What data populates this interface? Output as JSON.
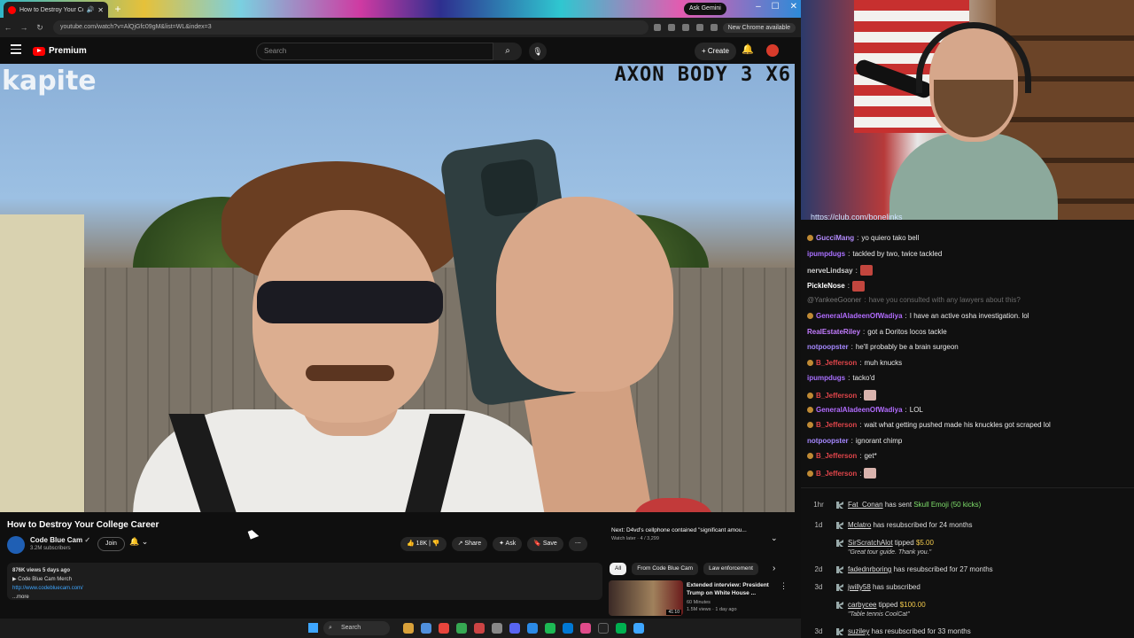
{
  "browser": {
    "tab_title": "How to Destroy Your Colle",
    "gemini_label": "Ask Gemini",
    "url": "youtube.com/watch?v=AlQjGfc09gM&list=WL&index=3",
    "new_chrome_label": "New Chrome available"
  },
  "youtube": {
    "logo_text": "Premium",
    "search_placeholder": "Search",
    "create_label": "Create"
  },
  "video": {
    "watermark_left": "kapite",
    "watermark_right": "AXON BODY 3 X6"
  },
  "details": {
    "title": "How to Destroy Your College Career",
    "channel_name": "Code Blue Cam",
    "subscribers": "3.2M subscribers",
    "join_label": "Join",
    "like_count": "18K",
    "share_label": "Share",
    "ask_label": "Ask",
    "save_label": "Save",
    "desc_stats": "876K views  5 days ago",
    "desc_merch": "▶ Code Blue Cam Merch",
    "desc_link": "http://www.codebluecam.com/",
    "desc_more": "...more"
  },
  "up_next": {
    "title": "Next: D4vd's cellphone contained \"significant amou...",
    "sub": "Watch later · 4 / 3,299"
  },
  "chips": [
    "All",
    "From Code Blue Cam",
    "Law enforcement"
  ],
  "recommended": {
    "title": "Extended interview: President Trump on White House ...",
    "channel": "60 Minutes",
    "meta": "1.5M views · 1 day ago",
    "duration": "41:10"
  },
  "streamer": {
    "chat_link": "https://club.com/bonelinks"
  },
  "chat": [
    {
      "user": "GucciMang",
      "text": "yo quiero tako bell",
      "color": "#b58cff",
      "badge": true
    },
    {
      "user": "ipumpdugs",
      "text": "tackled by two, twice tackled",
      "color": "#a970ff",
      "badge": false
    },
    {
      "user": "nerveLindsay",
      "text": "",
      "color": "#cfcfcf",
      "emote": "red",
      "badge": false
    },
    {
      "user": "PickleNose",
      "text": "",
      "color": "#ffffff",
      "emote": "red",
      "badge": false
    },
    {
      "user": "@YankeeGooner",
      "text": "have you consulted with any lawyers about this?",
      "color": "#777777",
      "dim": true,
      "badge": false
    },
    {
      "user": "GeneralAladeenOfWadiya",
      "text": "I have an active osha investigation. lol",
      "color": "#b26cff",
      "badge": true
    },
    {
      "user": "RealEstateRiley",
      "text": "got a Doritos locos tackle",
      "color": "#c37cff",
      "badge": false
    },
    {
      "user": "notpoopster",
      "text": "he'll probably be a brain surgeon",
      "color": "#a688ff",
      "badge": false
    },
    {
      "user": "B_Jefferson",
      "text": "muh knucks",
      "color": "#e0454a",
      "badge": true
    },
    {
      "user": "ipumpdugs",
      "text": "tacko'd",
      "color": "#a970ff",
      "badge": false
    },
    {
      "user": "B_Jefferson",
      "text": "",
      "color": "#e0454a",
      "emote": "pink",
      "badge": true
    },
    {
      "user": "GeneralAladeenOfWadiya",
      "text": "LOL",
      "color": "#b26cff",
      "badge": true
    },
    {
      "user": "B_Jefferson",
      "text": "wait what getting pushed made his knuckles got scraped lol",
      "color": "#e0454a",
      "badge": true
    },
    {
      "user": "notpoopster",
      "text": "ignorant chimp",
      "color": "#a688ff",
      "badge": false
    },
    {
      "user": "B_Jefferson",
      "text": "get*",
      "color": "#e0454a",
      "badge": true
    },
    {
      "user": "B_Jefferson",
      "text": "",
      "color": "#e0454a",
      "emote": "pink",
      "badge": true
    }
  ],
  "events": [
    {
      "time": "1hr",
      "who": "Fat_Conan",
      "pre": " has sent ",
      "hl": "Skull Emoji (50 kicks)",
      "amt": "",
      "post": "",
      "note": ""
    },
    {
      "time": "1d",
      "who": "Mclatro",
      "pre": " has resubscribed for 24 months",
      "hl": "",
      "amt": "",
      "post": "",
      "note": ""
    },
    {
      "time": "",
      "who": "SirScratchAlot",
      "pre": " tipped ",
      "hl": "",
      "amt": "$5.00",
      "post": "",
      "note": "\"Great tour guide. Thank you.\""
    },
    {
      "time": "2d",
      "who": "fadednrboring",
      "pre": " has resubscribed for 27 months",
      "hl": "",
      "amt": "",
      "post": "",
      "note": ""
    },
    {
      "time": "3d",
      "who": "jwilly58",
      "pre": " has subscribed",
      "hl": "",
      "amt": "",
      "post": "",
      "note": ""
    },
    {
      "time": "",
      "who": "carbycee",
      "pre": " tipped ",
      "hl": "",
      "amt": "$100.00",
      "post": "",
      "note": "\"Table tennis CoolCat\""
    },
    {
      "time": "3d",
      "who": "suziley",
      "pre": " has resubscribed for 33 months",
      "hl": "",
      "amt": "",
      "post": "",
      "note": ""
    }
  ],
  "taskbar": {
    "search_label": "Search"
  }
}
